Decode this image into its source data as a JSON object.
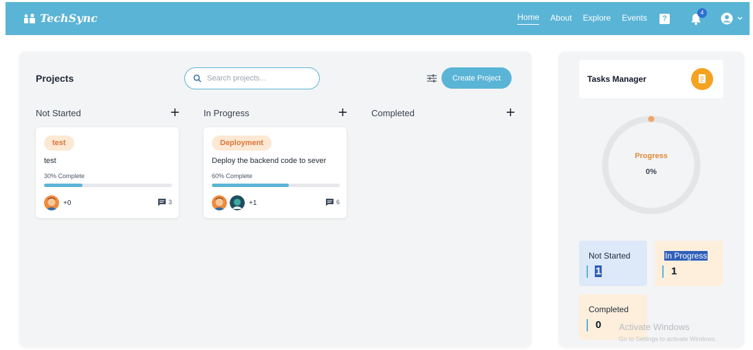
{
  "app": {
    "name": "TechSync"
  },
  "nav": {
    "links": [
      "Home",
      "About",
      "Explore",
      "Events"
    ],
    "help_glyph": "?",
    "notification_count": "4"
  },
  "projects": {
    "title": "Projects",
    "search_placeholder": "Search projects...",
    "create_label": "Create Project",
    "columns": [
      {
        "title": "Not Started"
      },
      {
        "title": "In Progress"
      },
      {
        "title": "Completed"
      }
    ],
    "cards": [
      {
        "tag": "test",
        "description": "test",
        "progress_text": "30% Complete",
        "progress": 0.3,
        "extra_members": "+0",
        "comments": "3"
      },
      {
        "tag": "Deployment",
        "description": "Deploy the backend code to sever",
        "progress_text": "60% Complete",
        "progress": 0.6,
        "extra_members": "+1",
        "comments": "6"
      }
    ]
  },
  "tasks": {
    "title": "Tasks Manager",
    "progress_label": "Progress",
    "progress_value": "0%",
    "stats": [
      {
        "label": "Not Started",
        "value": "1"
      },
      {
        "label": "In Progress",
        "value": "1"
      },
      {
        "label": "Completed",
        "value": "0"
      }
    ]
  },
  "watermark": {
    "title": "Activate Windows",
    "subtitle": "Go to Settings to activate Windows."
  },
  "colors": {
    "accent": "#5ab4d6",
    "tag_bg": "#fde8d3",
    "tag_text": "#d9743b",
    "task_icon": "#f4a21f",
    "not_started_bg": "#dde8f8",
    "in_progress_bg": "#fdefdc",
    "completed_bg": "#fdefdc"
  },
  "icons": [
    "people-logo-icon",
    "bell-icon",
    "user-circle-icon",
    "chevron-down-icon",
    "search-icon",
    "sliders-icon",
    "plus-icon",
    "comment-icon",
    "clipboard-icon"
  ]
}
